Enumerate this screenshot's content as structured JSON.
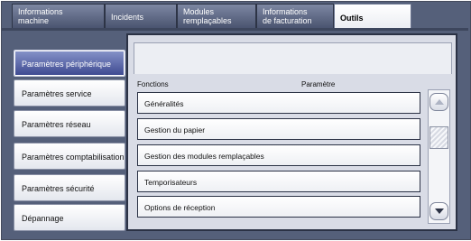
{
  "tabs": [
    {
      "label": "Informations machine",
      "line1": "Informations",
      "line2": "machine"
    },
    {
      "label": "Incidents"
    },
    {
      "label": "Modules remplaçables",
      "line1": "Modules",
      "line2": "remplaçables"
    },
    {
      "label": "Informations de facturation",
      "line1": "Informations",
      "line2": "de facturation"
    },
    {
      "label": "Outils"
    }
  ],
  "active_tab": "Outils",
  "sidebar": {
    "items": [
      {
        "label": "Paramètres périphérique",
        "selected": true
      },
      {
        "label": "Paramètres service",
        "selected": false
      },
      {
        "label": "Paramètres réseau",
        "selected": false
      },
      {
        "label": "Paramètres comptabilisation",
        "selected": false
      },
      {
        "label": "Paramètres sécurité",
        "selected": false
      },
      {
        "label": "Dépannage",
        "selected": false
      }
    ]
  },
  "table": {
    "headers": {
      "functions": "Fonctions",
      "parameter": "Paramètre"
    },
    "rows": [
      {
        "label": "Généralités"
      },
      {
        "label": "Gestion du papier"
      },
      {
        "label": "Gestion des modules remplaçables"
      },
      {
        "label": "Temporisateurs"
      },
      {
        "label": "Options de réception"
      }
    ]
  },
  "scrollbar": {
    "up_icon": "chevron-up-icon",
    "down_icon": "chevron-down-icon",
    "up_enabled": false,
    "down_enabled": true
  },
  "colors": {
    "frame": "#55607a",
    "selected": "#3c4890",
    "panel": "#d9dce6"
  }
}
